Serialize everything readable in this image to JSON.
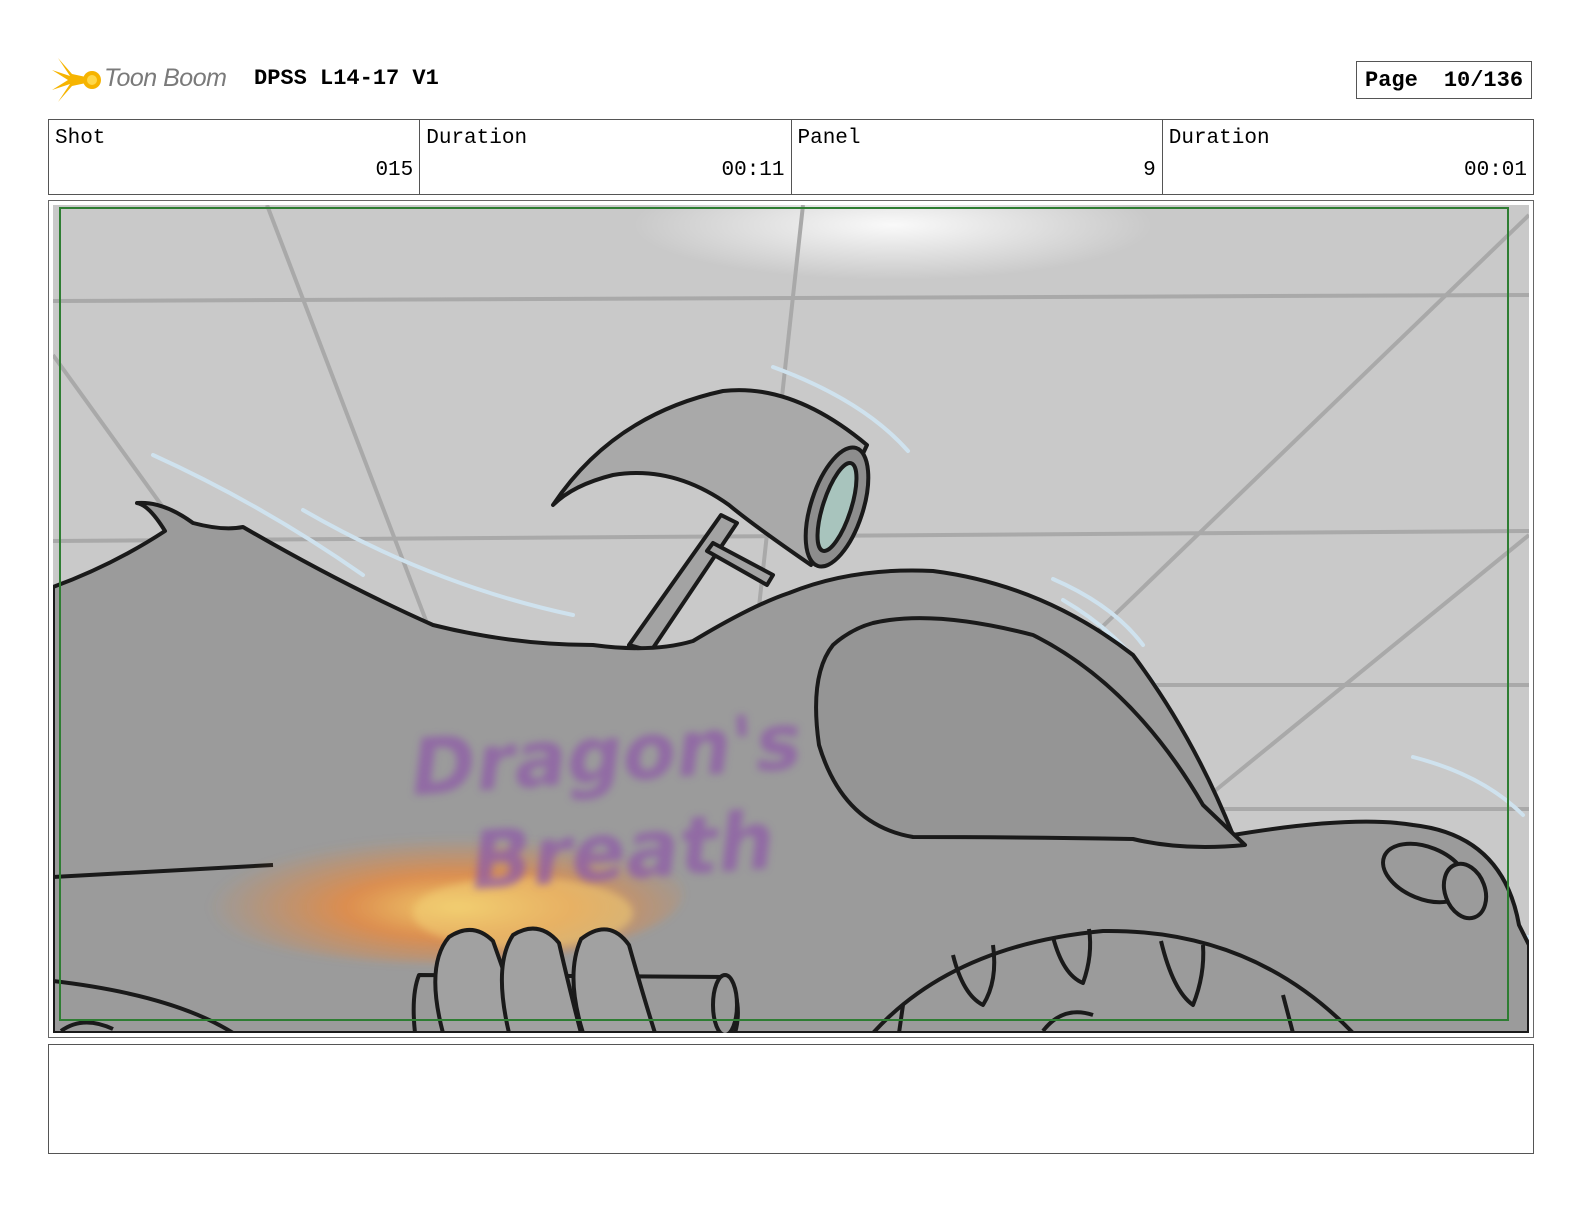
{
  "header": {
    "logo_text": "Toon Boom",
    "project_title": "DPSS L14-17 V1",
    "page_label": "Page",
    "page_number": "10/136"
  },
  "info": [
    {
      "label": "Shot",
      "value": "015"
    },
    {
      "label": "Duration",
      "value": "00:11"
    },
    {
      "label": "Panel",
      "value": "9"
    },
    {
      "label": "Duration",
      "value": "00:01"
    }
  ],
  "panel": {
    "sketch_text_line1": "Dragon's",
    "sketch_text_line2": "Breath",
    "colors": {
      "background": "#c9c9c9",
      "vehicle": "#9b9b9b",
      "lettering": "#8e5aa8",
      "flame": "#e8873a",
      "safe_frame": "#2e7d32"
    }
  },
  "notes": {
    "text": ""
  }
}
